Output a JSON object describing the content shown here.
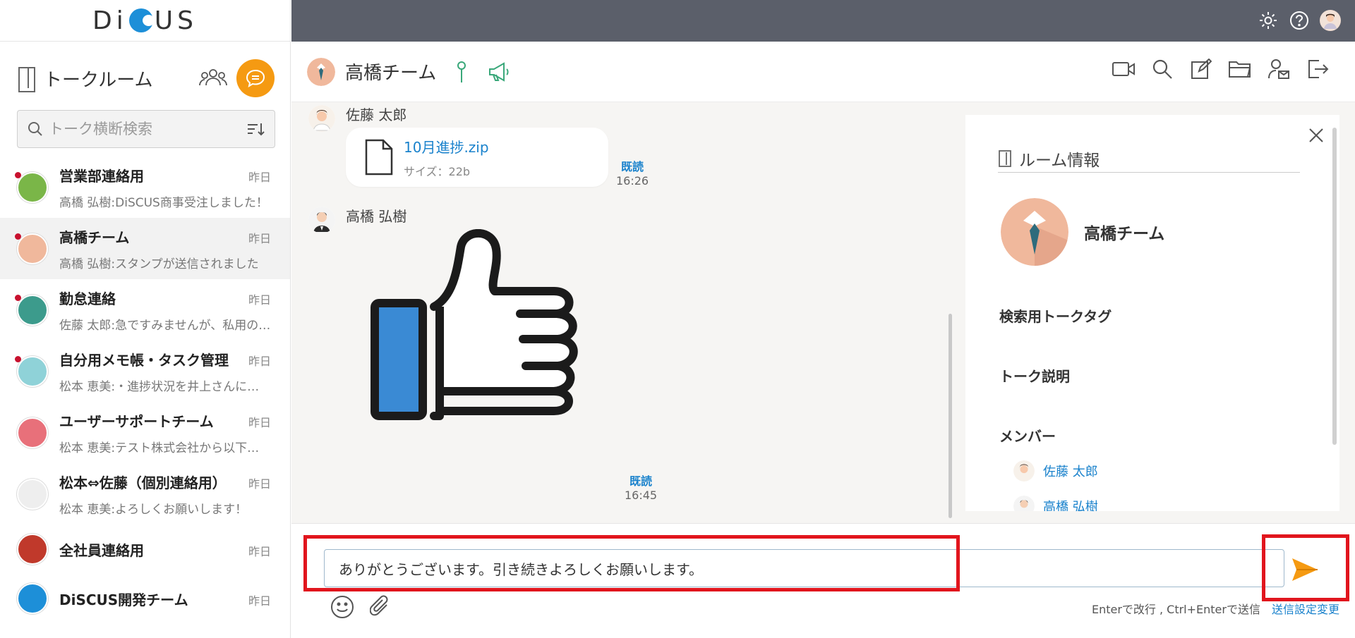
{
  "app": {
    "logo_text_left": "Di",
    "logo_text_right": "US"
  },
  "sidebar": {
    "title": "トークルーム",
    "search_placeholder": "トーク横断検索",
    "rooms": [
      {
        "name": "営業部連絡用",
        "date": "昨日",
        "preview": "高橋 弘樹:DiSCUS商事受注しました！",
        "unread": true,
        "active": false,
        "avatar_color": "#7ab648"
      },
      {
        "name": "高橋チーム",
        "date": "昨日",
        "preview": "高橋 弘樹:スタンプが送信されました",
        "unread": true,
        "active": true,
        "avatar_color": "#f0b89c"
      },
      {
        "name": "勤怠連絡",
        "date": "昨日",
        "preview": "佐藤 太郎:急ですみませんが、私用のため",
        "unread": true,
        "active": false,
        "avatar_color": "#3c9b8c"
      },
      {
        "name": "自分用メモ帳・タスク管理",
        "date": "昨日",
        "preview": "松本 恵美:・進捗状況を井上さんに報告",
        "unread": true,
        "active": false,
        "avatar_color": "#8fd2d8"
      },
      {
        "name": "ユーザーサポートチーム",
        "date": "昨日",
        "preview": "松本 恵美:テスト株式会社から以下の問い合わせ",
        "unread": false,
        "active": false,
        "avatar_color": "#e8707a"
      },
      {
        "name": "松本⇔佐藤（個別連絡用）",
        "date": "昨日",
        "preview": "松本 恵美:よろしくお願いします！",
        "unread": false,
        "active": false,
        "avatar_color": "#eeeeee"
      },
      {
        "name": "全社員連絡用",
        "date": "昨日",
        "preview": "",
        "unread": false,
        "active": false,
        "avatar_color": "#c0392b"
      },
      {
        "name": "DiSCUS開発チーム",
        "date": "昨日",
        "preview": "",
        "unread": false,
        "active": false,
        "avatar_color": "#1d8fd8"
      }
    ]
  },
  "chat": {
    "room_name": "高橋チーム",
    "messages": [
      {
        "sender": "佐藤 太郎",
        "file_name": "10月進捗.zip",
        "file_size": "サイズ：22b",
        "read_label": "既読",
        "time": "16:26"
      },
      {
        "sender": "高橋 弘樹",
        "stamp": "thumbs-up",
        "read_label": "既読",
        "time": "16:45"
      }
    ]
  },
  "room_info": {
    "title": "ルーム情報",
    "room_name": "高橋チーム",
    "tag_section": "検索用トークタグ",
    "description_section": "トーク説明",
    "members_section": "メンバー",
    "members": [
      "佐藤 太郎",
      "高橋 弘樹"
    ]
  },
  "composer": {
    "value": "ありがとうございます。引き続きよろしくお願いします。",
    "hint": "Enterで改行 , Ctrl+Enterで送信",
    "settings_link": "送信設定変更"
  },
  "colors": {
    "accent_orange": "#f59a12",
    "link_blue": "#1a82cc",
    "topbar": "#5b5f6a",
    "highlight_red": "#e1151d"
  }
}
